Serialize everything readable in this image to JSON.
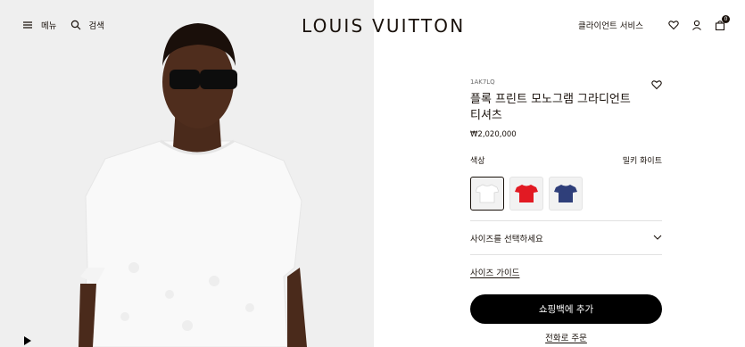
{
  "header": {
    "menu_label": "메뉴",
    "search_label": "검색",
    "logo": "LOUIS VUITTON",
    "client_service": "클라이언트 서비스",
    "cart_count": "0",
    "icons": [
      "hamburger-icon",
      "search-icon",
      "heart-icon",
      "user-icon",
      "shopping-bag-icon"
    ]
  },
  "product": {
    "sku": "1AK7LQ",
    "title": "플록 프린트 모노그램 그라디언트 티셔츠",
    "price": "₩2,020,000",
    "color_label": "색상",
    "color_value": "밀키 화이트",
    "swatches": [
      {
        "name": "white",
        "color": "#f7f7f5",
        "selected": true
      },
      {
        "name": "red",
        "color": "#e21a23",
        "selected": false
      },
      {
        "name": "navy",
        "color": "#2f3f7a",
        "selected": false
      }
    ],
    "size_select": "사이즈를 선택하세요",
    "size_guide": "사이즈 가이드",
    "add_to_cart": "쇼핑백에 추가",
    "phone_order": "전화로 주문"
  },
  "colors": {
    "text": "#19110b",
    "button": "#000000",
    "hero_bg": "#efefef"
  }
}
